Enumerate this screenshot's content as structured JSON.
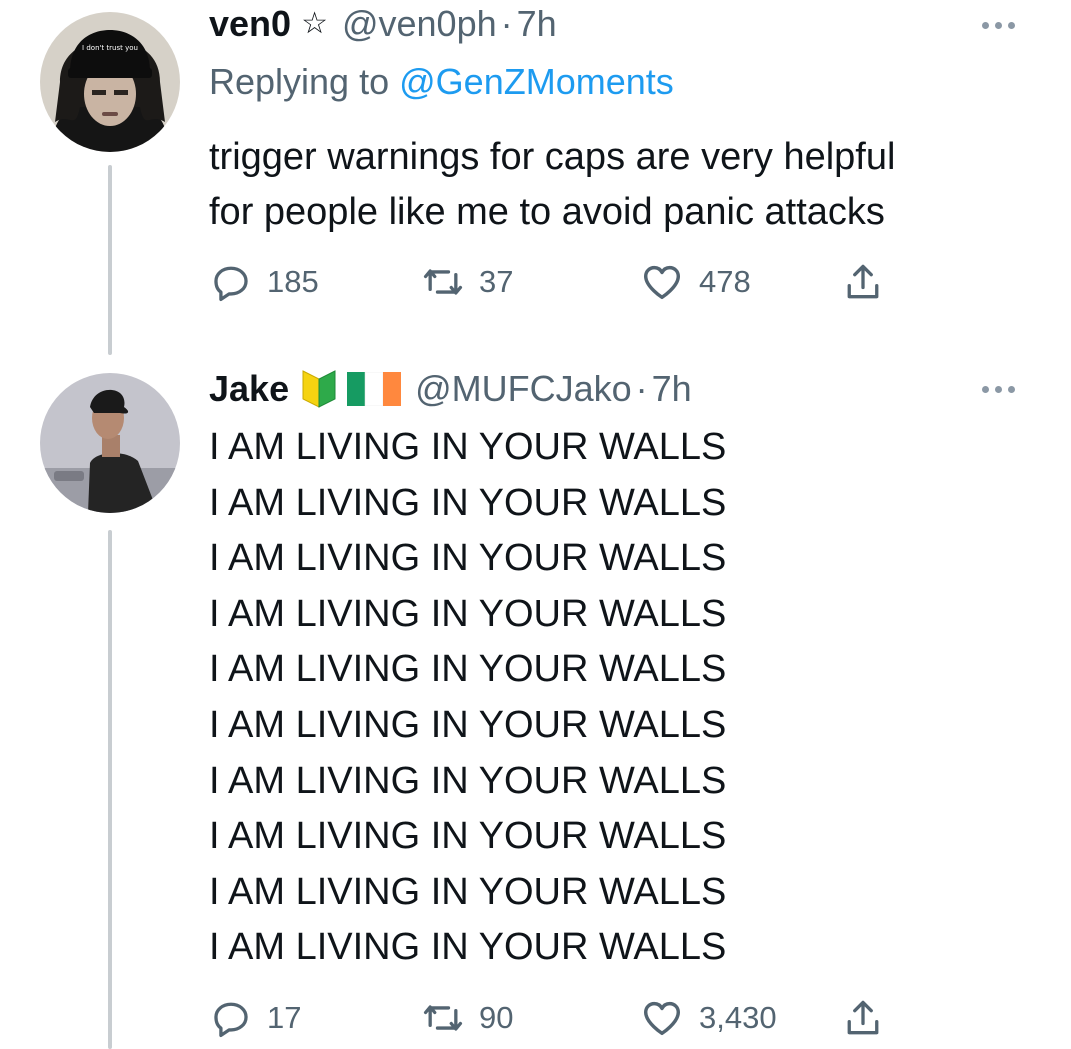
{
  "tweet1": {
    "display_name": "ven0",
    "star": "☆",
    "handle": "@ven0ph",
    "separator": "·",
    "timestamp": "7h",
    "replying_prefix": "Replying to",
    "replying_to": "@GenZMoments",
    "avatar_cap_text": "I don't trust you",
    "text_lines": [
      "trigger warnings for caps are very helpful",
      "for people like me to avoid panic attacks"
    ],
    "replies": "185",
    "retweets": "37",
    "likes": "478"
  },
  "tweet2": {
    "display_name": "Jake",
    "handle": "@MUFCJako",
    "separator": "·",
    "timestamp": "7h",
    "badge_icon": "beginner-badge-icon",
    "flag_icon": "ireland-flag-icon",
    "text_lines": [
      "I AM LIVING IN YOUR WALLS",
      "I AM LIVING IN YOUR WALLS",
      "I AM LIVING IN YOUR WALLS",
      "I AM LIVING IN YOUR WALLS",
      "I AM LIVING IN YOUR WALLS",
      "I AM LIVING IN YOUR WALLS",
      "I AM LIVING IN YOUR WALLS",
      "I AM LIVING IN YOUR WALLS",
      "I AM LIVING IN YOUR WALLS",
      "I AM LIVING IN YOUR WALLS"
    ],
    "replies": "17",
    "retweets": "90",
    "likes": "3,430"
  },
  "colors": {
    "text": "#0f1419",
    "secondary": "#536471",
    "link": "#1d9bf0",
    "thread_line": "#c8cdd1",
    "flag_green": "#169b62",
    "flag_orange": "#ff883e",
    "badge_yellow": "#f5d311",
    "badge_green": "#2eaa4a"
  }
}
